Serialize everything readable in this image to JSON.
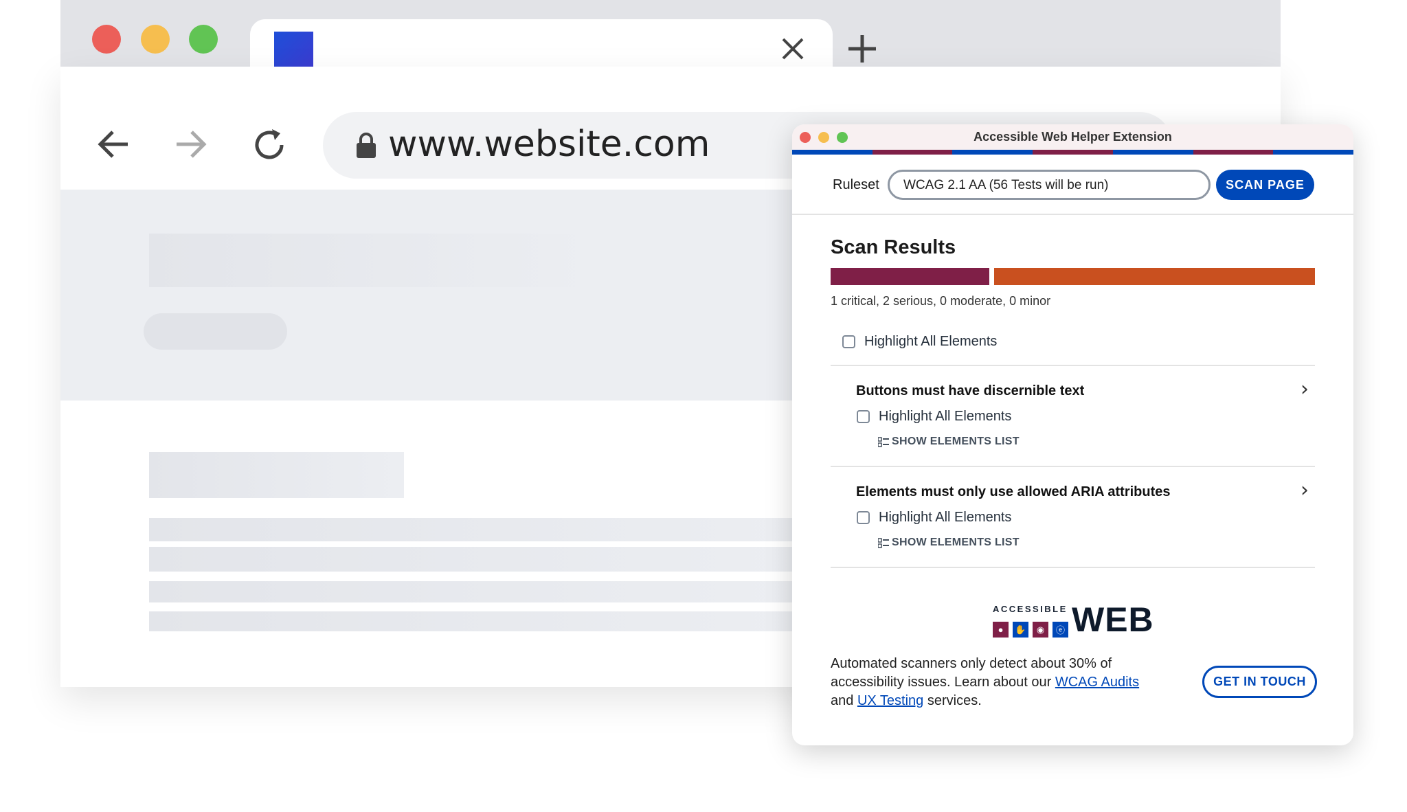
{
  "browser": {
    "url": "www.website.com",
    "tab_close_icon": "close-icon",
    "new_tab_icon": "plus-icon"
  },
  "extension": {
    "title": "Accessible Web Helper Extension",
    "ruleset_label": "Ruleset",
    "ruleset_value": "WCAG 2.1 AA (56 Tests will be run)",
    "scan_button": "SCAN PAGE",
    "results_heading": "Scan Results",
    "severity": {
      "critical": 1,
      "serious": 2,
      "moderate": 0,
      "minor": 0
    },
    "summary": "1 critical, 2 serious, 0 moderate, 0 minor",
    "highlight_all": "Highlight All Elements",
    "rules": [
      {
        "title": "Buttons must have discernible text",
        "highlight": "Highlight All Elements",
        "show_list": "SHOW ELEMENTS LIST"
      },
      {
        "title": "Elements must only use allowed ARIA attributes",
        "highlight": "Highlight All Elements",
        "show_list": "SHOW ELEMENTS LIST"
      }
    ],
    "logo": {
      "small": "ACCESSIBLE",
      "big": "WEB"
    },
    "footer": {
      "text1": "Automated scanners only detect about 30% of accessibility issues. Learn about our ",
      "link1": "WCAG Audits",
      "text2": " and ",
      "link2": "UX Testing",
      "text3": " services."
    },
    "contact_button": "GET IN TOUCH",
    "colors": {
      "blue": "#0048b8",
      "crimson": "#7f1f47",
      "orange": "#c9501f"
    }
  }
}
